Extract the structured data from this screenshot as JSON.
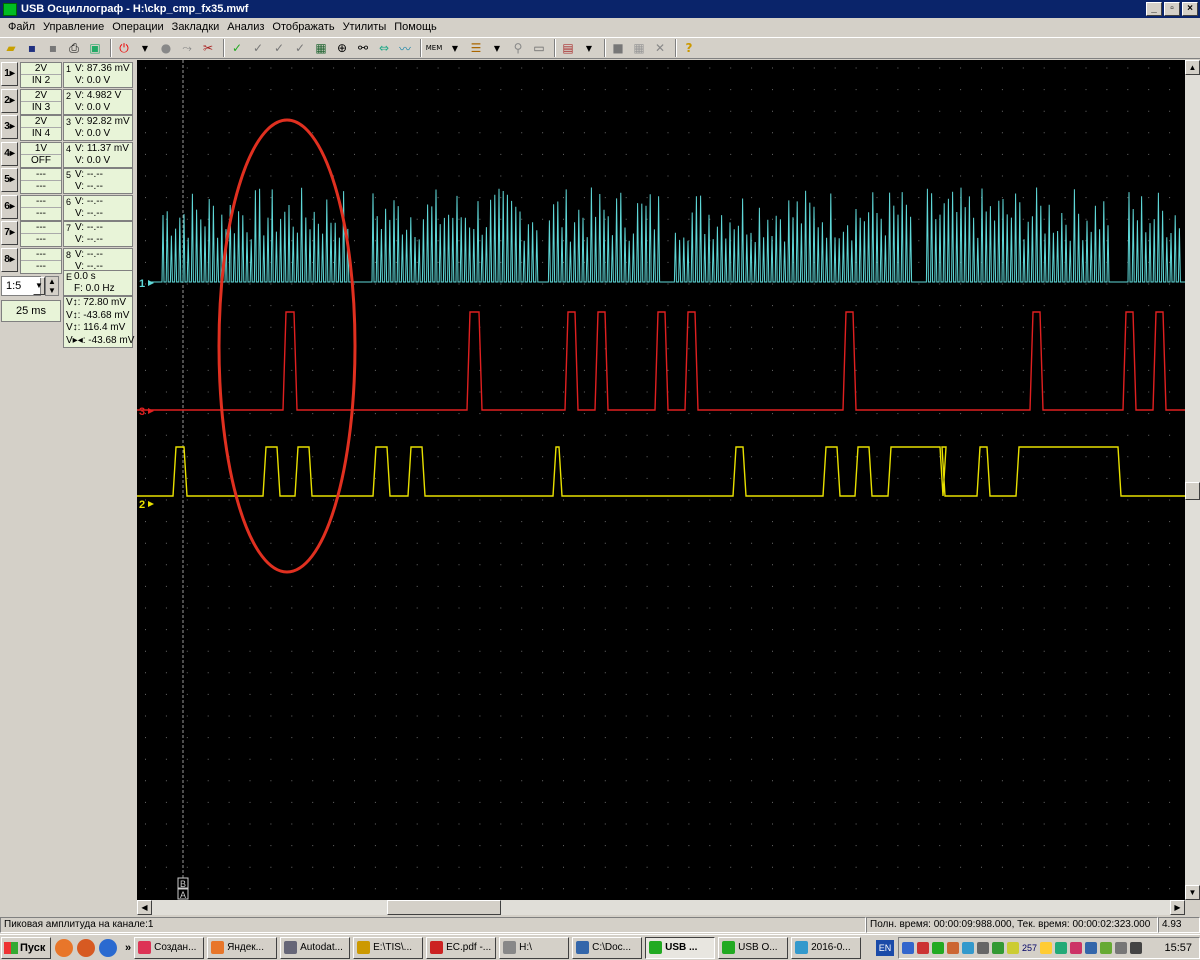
{
  "window": {
    "title": "USB Осциллограф - H:\\ckp_cmp_fx35.mwf"
  },
  "menu": [
    "Файл",
    "Управление",
    "Операции",
    "Закладки",
    "Анализ",
    "Отображать",
    "Утилиты",
    "Помощь"
  ],
  "channels": [
    {
      "num": "1",
      "btn": "1",
      "scale": "2V",
      "input": "IN 2",
      "v": "V: 87.36 mV",
      "dv": "V: 0.0 V",
      "color": "#5fd8d8"
    },
    {
      "num": "2",
      "btn": "2",
      "scale": "2V",
      "input": "IN 3",
      "v": "V: 4.982 V",
      "dv": "V: 0.0 V",
      "color": "#e8e000"
    },
    {
      "num": "3",
      "btn": "3",
      "scale": "2V",
      "input": "IN 4",
      "v": "V: 92.82 mV",
      "dv": "V: 0.0 V",
      "color": "#e02020"
    },
    {
      "num": "4",
      "btn": "4",
      "scale": "1V",
      "input": "OFF",
      "v": "V: 11.37 mV",
      "dv": "V: 0.0 V",
      "color": "#ffffff"
    },
    {
      "num": "5",
      "btn": "5",
      "scale": "---",
      "input": "---",
      "v": "V: --.--",
      "dv": "V: --.--"
    },
    {
      "num": "6",
      "btn": "6",
      "scale": "---",
      "input": "---",
      "v": "V: --.--",
      "dv": "V: --.--"
    },
    {
      "num": "7",
      "btn": "7",
      "scale": "---",
      "input": "---",
      "v": "V: --.--",
      "dv": "V: --.--"
    },
    {
      "num": "8",
      "btn": "8",
      "scale": "---",
      "input": "---",
      "v": "V: --.--",
      "dv": "V: --.--"
    }
  ],
  "time_meas": {
    "e": "E",
    "t": "0.0 s",
    "f": "F: 0.0 Hz"
  },
  "scale_value": "1:5",
  "time_div": "25 ms",
  "delta_meas": [
    "V↕: 72.80 mV",
    "V↕: -43.68 mV",
    "V↕: 116.4 mV",
    "V▸◂: -43.68 mV"
  ],
  "markers": {
    "ch1": "1",
    "ch3": "3",
    "ch2": "2",
    "cursor_b": "B",
    "cursor_a": "A"
  },
  "status": {
    "message": "Пиковая амплитуда на канале:1",
    "times": "Полн. время: 00:00:09:988.000, Тек. время: 00:00:02:323.000",
    "value": "4.93"
  },
  "taskbar": {
    "start": "Пуск",
    "tasks": [
      "Создан...",
      "Яндек...",
      "Autodat...",
      "E:\\TIS\\...",
      "EC.pdf -...",
      "H:\\",
      "C:\\Doc...",
      "USB ...",
      "USB O...",
      "2016-0..."
    ],
    "lang": "EN",
    "tray_count": "257",
    "clock": "15:57"
  },
  "colors": {
    "ch1": "#5fd8d8",
    "ch2": "#e8e000",
    "ch3": "#e02020",
    "annotation": "#e03020"
  }
}
